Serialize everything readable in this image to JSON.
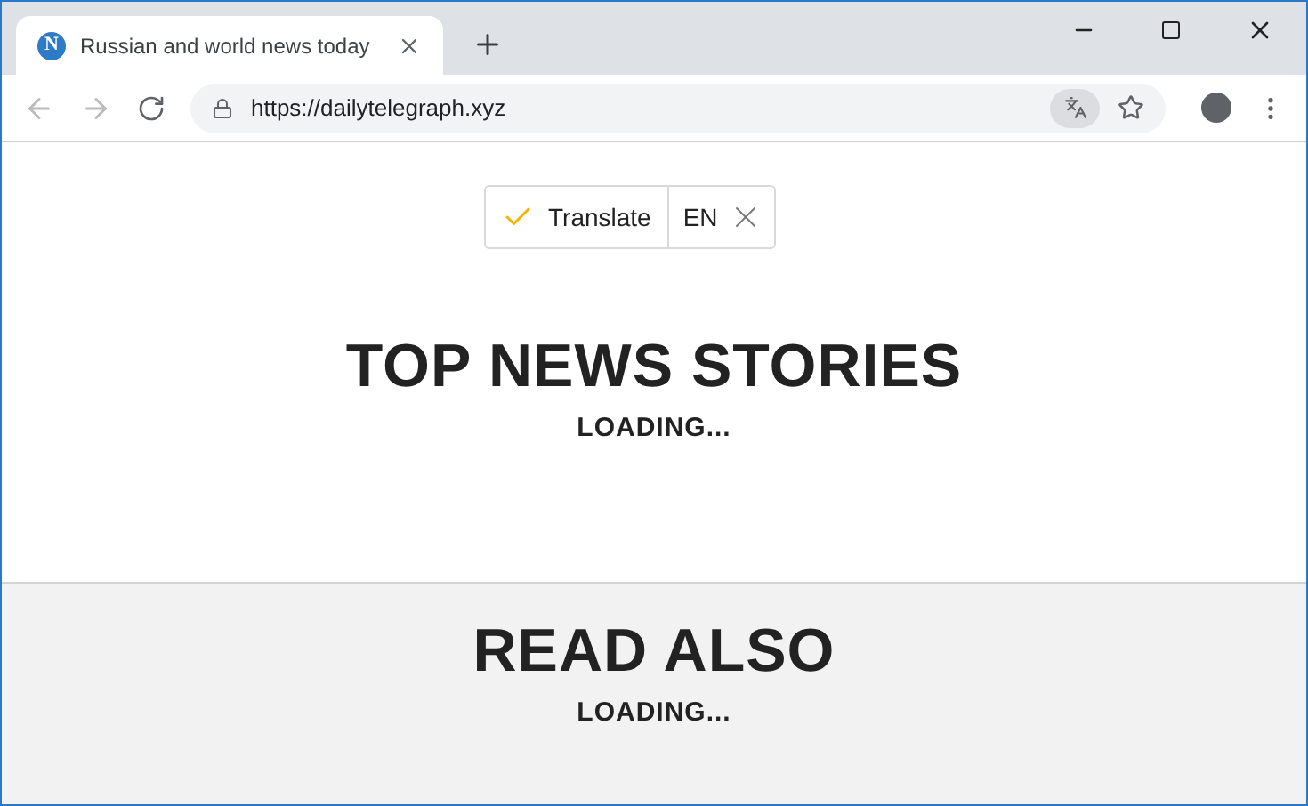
{
  "tab": {
    "favicon_letter": "N",
    "title": "Russian and world news today",
    "selected": true
  },
  "address_bar": {
    "url": "https://dailytelegraph.xyz"
  },
  "translate_widget": {
    "label": "Translate",
    "language": "EN"
  },
  "sections": [
    {
      "heading": "TOP NEWS STORIES",
      "status": "LOADING...",
      "kind": "plain"
    },
    {
      "heading": "READ ALSO",
      "status": "LOADING...",
      "kind": "shaded"
    }
  ]
}
